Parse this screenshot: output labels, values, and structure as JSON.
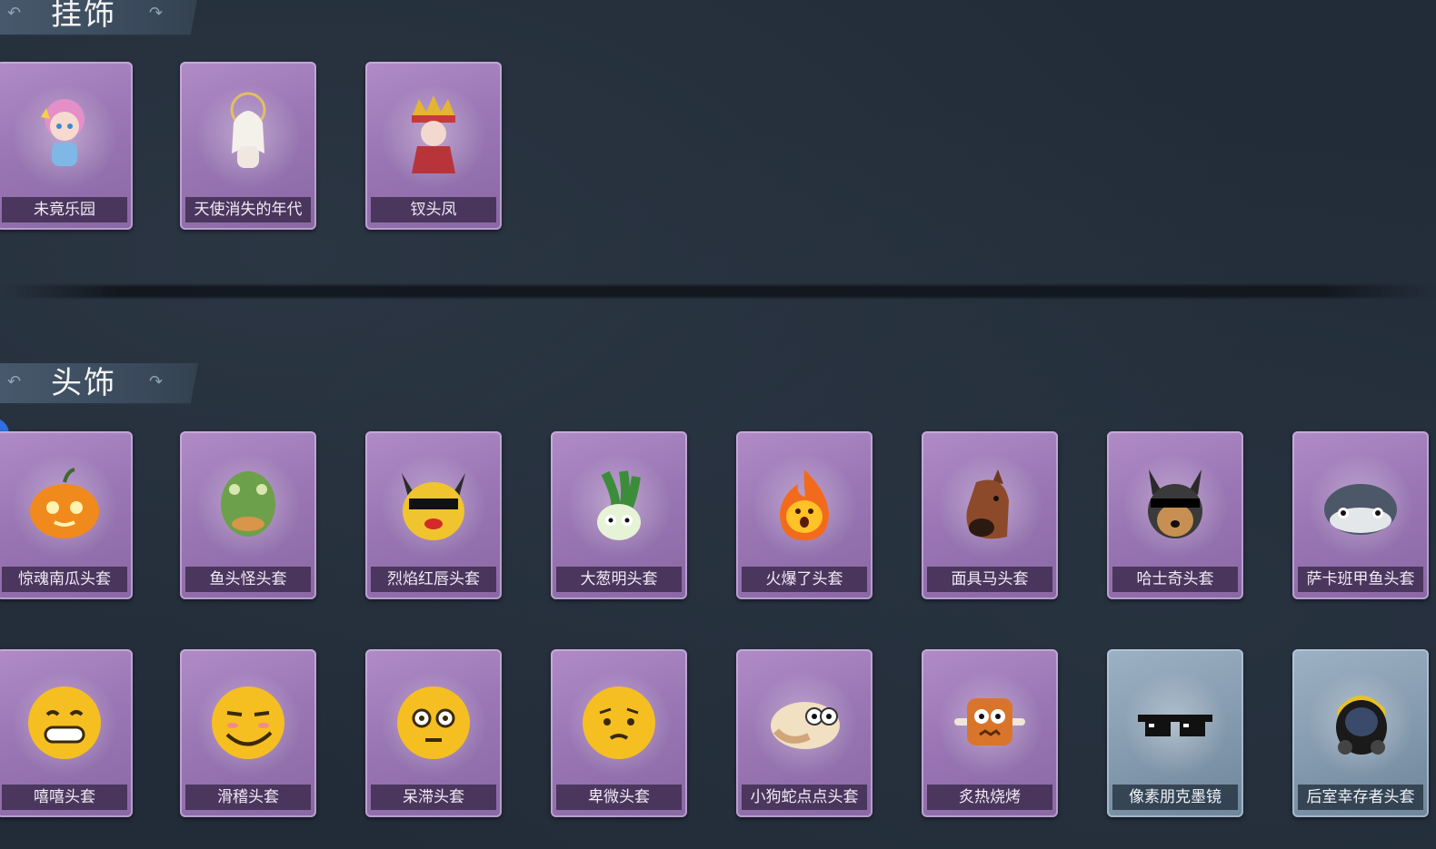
{
  "sections": {
    "pendants": {
      "title": "挂饰",
      "items": [
        {
          "label": "未竟乐园",
          "icon": "pendant-girl-icon"
        },
        {
          "label": "天使消失的年代",
          "icon": "pendant-angel-icon"
        },
        {
          "label": "钗头凤",
          "icon": "pendant-phoenix-crown-icon"
        }
      ]
    },
    "headwear": {
      "title": "头饰",
      "row1": [
        {
          "label": "惊魂南瓜头套",
          "icon": "pumpkin-icon"
        },
        {
          "label": "鱼头怪头套",
          "icon": "fish-head-icon"
        },
        {
          "label": "烈焰红唇头套",
          "icon": "pikachu-lips-icon"
        },
        {
          "label": "大葱明头套",
          "icon": "scallion-icon"
        },
        {
          "label": "火爆了头套",
          "icon": "fire-icon"
        },
        {
          "label": "面具马头套",
          "icon": "horse-mask-icon"
        },
        {
          "label": "哈士奇头套",
          "icon": "husky-icon"
        },
        {
          "label": "萨卡班甲鱼头套",
          "icon": "sacabambaspis-icon"
        }
      ],
      "row2": [
        {
          "label": "嘻嘻头套",
          "icon": "grin-emoji-icon"
        },
        {
          "label": "滑稽头套",
          "icon": "smirk-emoji-icon"
        },
        {
          "label": "呆滞头套",
          "icon": "blank-emoji-icon"
        },
        {
          "label": "卑微头套",
          "icon": "humble-emoji-icon"
        },
        {
          "label": "小狗蛇点点头套",
          "icon": "snake-dog-icon"
        },
        {
          "label": "炙热烧烤",
          "icon": "bbq-icon"
        },
        {
          "label": "像素朋克墨镜",
          "icon": "pixel-sunglasses-icon",
          "rarity": "blue"
        },
        {
          "label": "后室幸存者头套",
          "icon": "gas-mask-helmet-icon",
          "rarity": "blue"
        }
      ]
    }
  },
  "colors": {
    "background": "#222c38",
    "card_purple": "#9a77b4",
    "card_blue": "#8399ad",
    "header": "#3a4a5c"
  }
}
